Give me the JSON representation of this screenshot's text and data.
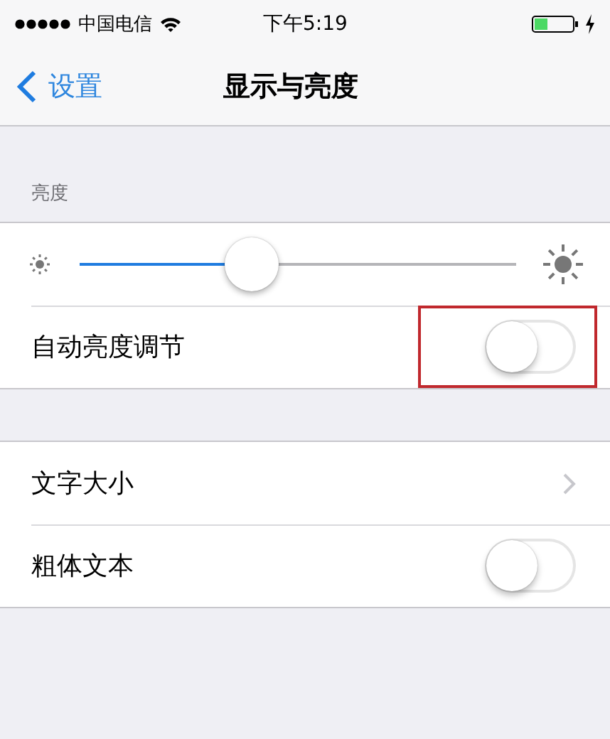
{
  "status_bar": {
    "carrier": "中国电信",
    "time": "下午5:19"
  },
  "nav_bar": {
    "back": "设置",
    "title": "显示与亮度"
  },
  "sections": [
    {
      "header": "亮度",
      "rows": [
        {
          "kind": "slider",
          "level": 0.38
        },
        {
          "kind": "toggle",
          "label": "自动亮度调节",
          "on": false,
          "highlighted": true
        }
      ]
    },
    {
      "rows": [
        {
          "kind": "disclosure",
          "label": "文字大小"
        },
        {
          "kind": "toggle",
          "label": "粗体文本",
          "on": false,
          "highlighted": false
        }
      ]
    }
  ]
}
